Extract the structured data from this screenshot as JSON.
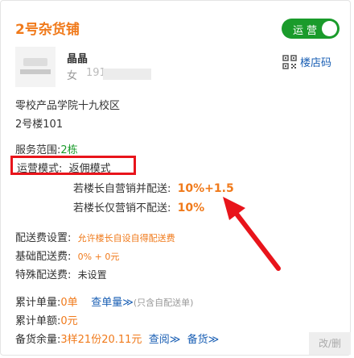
{
  "shop": {
    "title": "2号杂货铺",
    "status_label": "运营"
  },
  "manager": {
    "name": "晶晶",
    "gender": "女",
    "phone_prefix": "191",
    "qr_link": "楼店码"
  },
  "address": {
    "line1": "零校产品学院十九校区",
    "line2": "2号楼101"
  },
  "service": {
    "label": "服务范围:",
    "value": "2栋"
  },
  "mode": {
    "label": "运营模式:",
    "value": "返佣模式"
  },
  "commission": [
    {
      "label": "若楼长自营销并配送:",
      "value": "10%+1.5"
    },
    {
      "label": "若楼长仅营销不配送:",
      "value": "10%"
    }
  ],
  "delivery": {
    "fee_setting_label": "配送费设置:",
    "fee_setting_value": "允许楼长自设自得配送费",
    "base_fee_label": "基础配送费:",
    "base_fee_value": "0% + 0元",
    "special_fee_label": "特殊配送费:",
    "special_fee_value": "未设置"
  },
  "stats": {
    "orders_label": "累计单量:",
    "orders_value": "0单",
    "orders_link": "查单量≫",
    "orders_note": "(只含自配送单)",
    "amount_label": "累计单额:",
    "amount_value": "0元",
    "stock_label": "备货余量:",
    "stock_value": "3样21份20.11元",
    "stock_link1": "查阅≫",
    "stock_link2": "备货≫"
  },
  "edit_tag": "改/删",
  "colors": {
    "accent": "#f07a1b",
    "green": "#1a9b2b",
    "link": "#1a5fb4",
    "highlight": "#e8141b"
  }
}
